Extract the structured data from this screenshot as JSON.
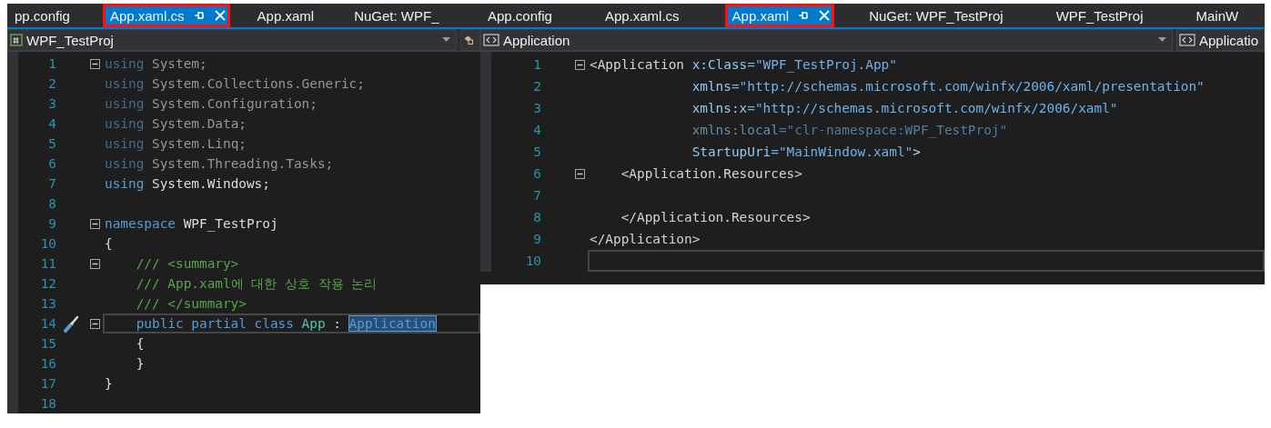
{
  "panels": [
    {
      "tabs": [
        {
          "label": "pp.config",
          "selected": false,
          "highlighted": false
        },
        {
          "label": "App.xaml.cs",
          "selected": true,
          "highlighted": true
        },
        {
          "label": "App.xaml",
          "selected": false,
          "highlighted": false
        },
        {
          "label": "NuGet: WPF_",
          "selected": false,
          "highlighted": false
        }
      ],
      "navigation": [
        {
          "kind": "csharp",
          "label": "WPF_TestProj"
        },
        {
          "kind": "member"
        }
      ],
      "lines": [
        {
          "number": "1",
          "fold": true,
          "faded": true,
          "tokens": [
            {
              "kind": "kw",
              "text": "using"
            },
            {
              "kind": "text",
              "text": " System;"
            }
          ]
        },
        {
          "number": "2",
          "fold": false,
          "faded": true,
          "tokens": [
            {
              "kind": "kw",
              "text": "using"
            },
            {
              "kind": "text",
              "text": " System.Collections.Generic;"
            }
          ]
        },
        {
          "number": "3",
          "fold": false,
          "faded": true,
          "tokens": [
            {
              "kind": "kw",
              "text": "using"
            },
            {
              "kind": "text",
              "text": " System.Configuration;"
            }
          ]
        },
        {
          "number": "4",
          "fold": false,
          "faded": true,
          "tokens": [
            {
              "kind": "kw",
              "text": "using"
            },
            {
              "kind": "text",
              "text": " System.Data;"
            }
          ]
        },
        {
          "number": "5",
          "fold": false,
          "faded": true,
          "tokens": [
            {
              "kind": "kw",
              "text": "using"
            },
            {
              "kind": "text",
              "text": " System.Linq;"
            }
          ]
        },
        {
          "number": "6",
          "fold": false,
          "faded": true,
          "tokens": [
            {
              "kind": "kw",
              "text": "using"
            },
            {
              "kind": "text",
              "text": " System.Threading.Tasks;"
            }
          ]
        },
        {
          "number": "7",
          "fold": false,
          "faded": false,
          "tokens": [
            {
              "kind": "kw",
              "text": "using"
            },
            {
              "kind": "text",
              "text": " System.Windows;"
            }
          ]
        },
        {
          "number": "8",
          "fold": false,
          "faded": false
        },
        {
          "number": "9",
          "fold": true,
          "faded": false,
          "tokens": [
            {
              "kind": "kw",
              "text": "namespace"
            },
            {
              "kind": "text",
              "text": " WPF_TestProj"
            }
          ]
        },
        {
          "number": "10",
          "fold": false,
          "faded": false,
          "tokens": [
            {
              "kind": "text",
              "text": "{"
            }
          ]
        },
        {
          "number": "11",
          "fold": true,
          "faded": false,
          "tokens": [
            {
              "kind": "comment",
              "text": "    /// <summary>"
            }
          ]
        },
        {
          "number": "12",
          "fold": false,
          "faded": false,
          "tokens": [
            {
              "kind": "comment",
              "text": "    /// App.xaml에 대한 상호 작용 논리"
            }
          ]
        },
        {
          "number": "13",
          "fold": false,
          "faded": false,
          "tokens": [
            {
              "kind": "comment",
              "text": "    /// </summary>"
            }
          ]
        },
        {
          "number": "14",
          "fold": true,
          "faded": false,
          "current": true,
          "quick_action": true,
          "tokens": [
            {
              "kind": "kw",
              "text": "    public partial class"
            },
            {
              "kind": "type",
              "text": " App"
            },
            {
              "kind": "text",
              "text": " : "
            },
            {
              "kind": "selected",
              "text": "Application"
            }
          ]
        },
        {
          "number": "15",
          "fold": false,
          "faded": false,
          "tokens": [
            {
              "kind": "text",
              "text": "    {"
            }
          ]
        },
        {
          "number": "16",
          "fold": false,
          "faded": false,
          "tokens": [
            {
              "kind": "text",
              "text": "    }"
            }
          ]
        },
        {
          "number": "17",
          "fold": false,
          "faded": false,
          "tokens": [
            {
              "kind": "text",
              "text": "}"
            }
          ]
        },
        {
          "number": "18",
          "fold": false,
          "faded": false
        }
      ]
    },
    {
      "tabs": [
        {
          "label": "App.config",
          "selected": false,
          "highlighted": false
        },
        {
          "label": "App.xaml.cs",
          "selected": false,
          "highlighted": false
        },
        {
          "label": "App.xaml",
          "selected": true,
          "highlighted": true
        },
        {
          "label": "NuGet: WPF_TestProj",
          "selected": false,
          "highlighted": false
        },
        {
          "label": "WPF_TestProj",
          "selected": false,
          "highlighted": false
        },
        {
          "label": "MainW",
          "selected": false,
          "highlighted": false
        }
      ],
      "navigation": [
        {
          "kind": "xml",
          "label": "Application"
        },
        {
          "kind": "xml",
          "label": "Applicatio"
        }
      ],
      "lines": [
        {
          "number": "1",
          "fold": true,
          "faded": false,
          "tokens": [
            {
              "kind": "tag",
              "text": "<Application"
            },
            {
              "kind": "attr",
              "text": " x:Class"
            },
            {
              "kind": "value",
              "text": "=\"WPF_TestProj.App\""
            }
          ]
        },
        {
          "number": "2",
          "fold": false,
          "faded": false,
          "tokens": [
            {
              "kind": "attr",
              "text": "             xmlns"
            },
            {
              "kind": "value",
              "text": "=\"http://schemas.microsoft.com/winfx/2006/xaml/presentation\""
            }
          ]
        },
        {
          "number": "3",
          "fold": false,
          "faded": false,
          "tokens": [
            {
              "kind": "attr",
              "text": "             xmlns:x"
            },
            {
              "kind": "value",
              "text": "=\"http://schemas.microsoft.com/winfx/2006/xaml\""
            }
          ]
        },
        {
          "number": "4",
          "fold": false,
          "faded": true,
          "tokens": [
            {
              "kind": "attr",
              "text": "             xmlns:local"
            },
            {
              "kind": "value",
              "text": "=\"clr-namespace:WPF_TestProj\""
            }
          ]
        },
        {
          "number": "5",
          "fold": false,
          "faded": false,
          "tokens": [
            {
              "kind": "attr",
              "text": "             StartupUri"
            },
            {
              "kind": "value",
              "text": "=\"MainWindow.xaml\""
            },
            {
              "kind": "tag",
              "text": ">"
            }
          ]
        },
        {
          "number": "6",
          "fold": true,
          "faded": false,
          "tokens": [
            {
              "kind": "tag",
              "text": "    <Application.Resources>"
            }
          ]
        },
        {
          "number": "7",
          "fold": false,
          "faded": false
        },
        {
          "number": "8",
          "fold": false,
          "faded": false,
          "tokens": [
            {
              "kind": "tag",
              "text": "    </Application.Resources>"
            }
          ]
        },
        {
          "number": "9",
          "fold": false,
          "faded": false,
          "tokens": [
            {
              "kind": "tag",
              "text": "</Application>"
            }
          ]
        },
        {
          "number": "10",
          "fold": false,
          "faded": false,
          "current": true
        }
      ]
    }
  ]
}
